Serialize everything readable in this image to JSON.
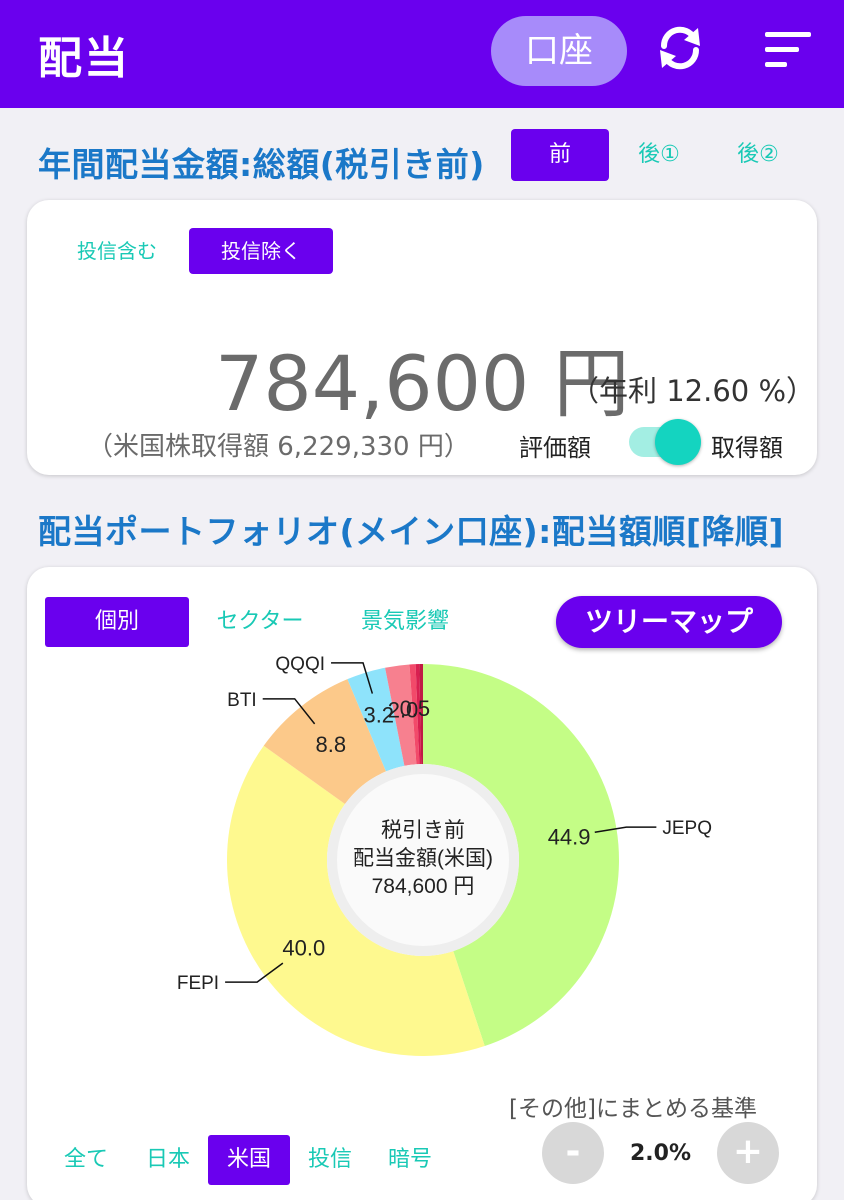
{
  "appbar": {
    "title": "配当",
    "account_label": "口座"
  },
  "annual": {
    "title": "年間配当金額:総額(税引き前)",
    "tax_tabs": [
      "前",
      "後①",
      "後②"
    ],
    "fund_tabs": [
      "投信含む",
      "投信除く"
    ],
    "amount": "784,600 円",
    "yield": "（年利 12.60 %）",
    "acquisition": "（米国株取得額 6,229,330 円）",
    "toggle_left": "評価額",
    "toggle_right": "取得額"
  },
  "portfolio": {
    "title": "配当ポートフォリオ(メイン口座):配当額順[降順]",
    "view_tabs": [
      "個別",
      "セクター",
      "景気影響"
    ],
    "treemap_label": "ツリーマップ",
    "center_line1": "税引き前",
    "center_line2": "配当金額(米国)",
    "center_line3": "784,600 円",
    "group_label": "[その他]にまとめる基準",
    "minus_label": "-",
    "plus_label": "+",
    "threshold": "2.0%",
    "region_tabs": [
      "全て",
      "日本",
      "米国",
      "投信",
      "暗号"
    ]
  },
  "chart_data": {
    "type": "pie",
    "title": "",
    "slices": [
      {
        "label": "JEPQ",
        "value": 44.9,
        "value_label": "44.9",
        "color": "#c4fd86"
      },
      {
        "label": "FEPI",
        "value": 40.0,
        "value_label": "40.0",
        "color": "#fef98f"
      },
      {
        "label": "BTI",
        "value": 8.8,
        "value_label": "8.8",
        "color": "#fcc98a"
      },
      {
        "label": "QQQI",
        "value": 3.2,
        "value_label": "3.2",
        "color": "#8ee3fb"
      },
      {
        "label": "",
        "value": 2.0,
        "value_label": "2.0",
        "color": "#f7808f"
      },
      {
        "label": "",
        "value": 0.5,
        "value_label": "0.5",
        "color": "#f24a6a"
      },
      {
        "label": "",
        "value": 0.3,
        "value_label": "",
        "color": "#d92050"
      },
      {
        "label": "",
        "value": 0.3,
        "value_label": "",
        "color": "#c01a45"
      }
    ]
  },
  "colors": {
    "accent": "#6a00ee",
    "title_blue": "#1b78c8",
    "teal": "#19c9b5"
  }
}
